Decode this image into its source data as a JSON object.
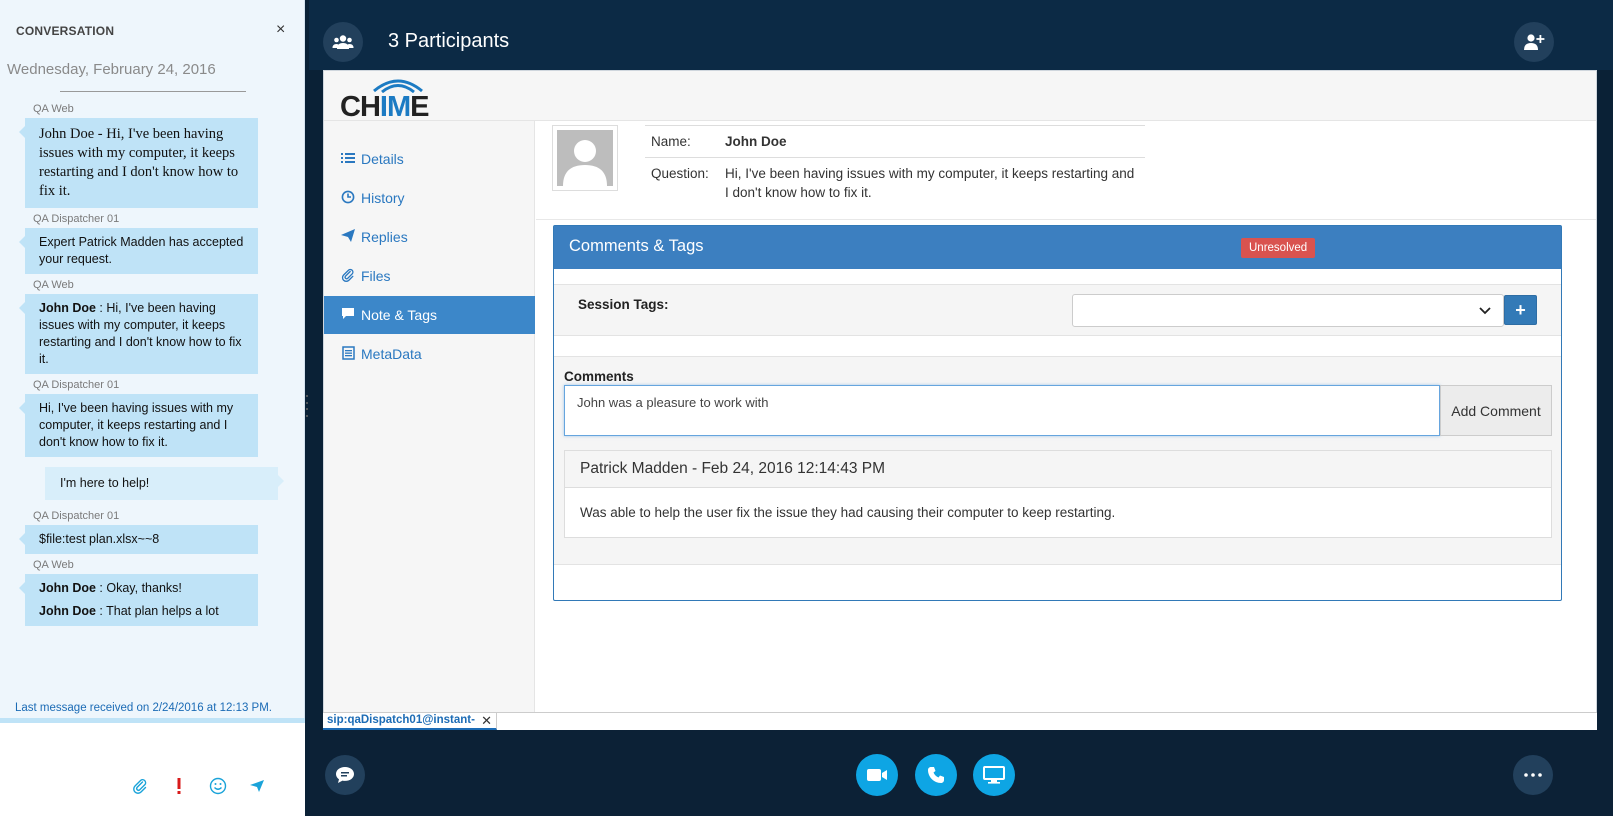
{
  "conversation": {
    "header": "CONVERSATION",
    "close_glyph": "×",
    "date": "Wednesday, February 24, 2016",
    "messages": [
      {
        "sender": "QA Web",
        "text": "John Doe - Hi, I've been having issues with my computer, it keeps restarting and I don't know how to fix it."
      },
      {
        "sender": "QA Dispatcher 01",
        "text": "Expert Patrick Madden has accepted your request."
      },
      {
        "sender": "QA Web",
        "name": "John Doe",
        "text": " : Hi, I've been having issues with my computer, it keeps restarting and I don't know how to fix it."
      },
      {
        "sender": "QA Dispatcher 01",
        "text": "Hi, I've been having issues with my computer, it keeps restarting and I don't know how to fix it."
      },
      {
        "sender": "",
        "text": "I'm here to help!"
      },
      {
        "sender": "QA Dispatcher 01",
        "text": "$file:test plan.xlsx~~8"
      },
      {
        "sender": "QA Web",
        "rows": [
          {
            "name": "John Doe",
            "text": " : Okay, thanks!"
          },
          {
            "name": "John Doe",
            "text": " : That plan helps a lot"
          }
        ]
      }
    ],
    "last_message": "Last message received on 2/24/2016 at 12:13 PM."
  },
  "topbar": {
    "participants": "3 Participants"
  },
  "app": {
    "logo_prefix": "CH",
    "logo_accent": "IM",
    "logo_suffix": "E",
    "nav": [
      {
        "label": "Details",
        "icon": "list-icon"
      },
      {
        "label": "History",
        "icon": "history-icon"
      },
      {
        "label": "Replies",
        "icon": "paper-plane-icon"
      },
      {
        "label": "Files",
        "icon": "paperclip-icon"
      },
      {
        "label": "Note & Tags",
        "icon": "comment-icon"
      },
      {
        "label": "MetaData",
        "icon": "document-icon"
      }
    ],
    "active_nav": "Note & Tags",
    "user": {
      "name_label": "Name:",
      "name": "John Doe",
      "question_label": "Question:",
      "question": "Hi, I've been having issues with my computer, it keeps restarting and I don't know how to fix it."
    },
    "panel": {
      "title": "Comments & Tags",
      "status": "Unresolved",
      "session_tags_label": "Session Tags:",
      "add_tag_glyph": "+",
      "comments_label": "Comments",
      "comment_value": "John was a pleasure to work with",
      "add_comment_label": "Add Comment",
      "comment": {
        "author_line": "Patrick Madden - Feb 24, 2016 12:14:43 PM",
        "body": "Was able to help the user fix the issue they had causing their computer to keep restarting."
      }
    }
  },
  "status_strip": {
    "sip_tab": "sip:qaDispatch01@instant-",
    "close_glyph": "✕"
  },
  "colors": {
    "accent": "#3c7fc0",
    "bubble": "#bfe3f7",
    "danger": "#d9534f",
    "call": "#0ea5e4",
    "chrome": "#0c2a45"
  }
}
